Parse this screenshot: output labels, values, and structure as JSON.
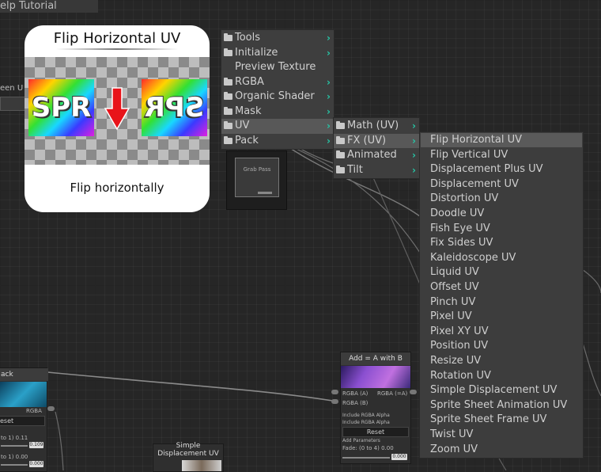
{
  "window": {
    "title": "elp Tutorial"
  },
  "left_panel": {
    "label": "een U"
  },
  "preview": {
    "title": "Flip Horizontal UV",
    "sprite_text": "SPR",
    "caption": "Flip horizontally"
  },
  "menu1": {
    "items": [
      {
        "label": "Tools",
        "folder": true,
        "submenu": true
      },
      {
        "label": "Initialize",
        "folder": true,
        "submenu": true
      },
      {
        "label": "Preview Texture",
        "folder": false,
        "submenu": false
      },
      {
        "label": "RGBA",
        "folder": true,
        "submenu": true
      },
      {
        "label": "Organic Shader",
        "folder": true,
        "submenu": true
      },
      {
        "label": "Mask",
        "folder": true,
        "submenu": true
      },
      {
        "label": "UV",
        "folder": true,
        "submenu": true,
        "selected": true
      },
      {
        "label": "Pack",
        "folder": true,
        "submenu": true
      }
    ]
  },
  "menu2": {
    "items": [
      {
        "label": "Math (UV)"
      },
      {
        "label": "FX (UV)",
        "selected": true
      },
      {
        "label": "Animated"
      },
      {
        "label": "Tilt"
      }
    ]
  },
  "menu3": {
    "items": [
      "Flip Horizontal UV",
      "Flip Vertical UV",
      "Displacement Plus UV",
      "Displacement UV",
      "Distortion UV",
      "Doodle UV",
      "Fish Eye UV",
      "Fix Sides UV",
      "Kaleidoscope UV",
      "Liquid UV",
      "Offset UV",
      "Pinch UV",
      "Pixel UV",
      "Pixel XY UV",
      "Position UV",
      "Resize UV",
      "Rotation UV",
      "Simple Displacement UV",
      "Sprite Sheet Animation UV",
      "Sprite Sheet Frame UV",
      "Twist UV",
      "Zoom UV"
    ]
  },
  "grab_node": {
    "label": "Grab Pass"
  },
  "node_pack": {
    "title": "ack",
    "output": "RGBA",
    "reset": "eset",
    "param1": "to 1) 0.11",
    "param1_value": "0.109",
    "param2": "to 1) 0.00",
    "param2_value": "0.000"
  },
  "node_add": {
    "title": "Add = A with B",
    "in_a": "RGBA (A)",
    "in_b": "RGBA (B)",
    "out": "RGBA (=A)",
    "opt1": "Include RGBA Alpha",
    "opt2": "Include RGBA Alpha",
    "reset": "Reset",
    "opt3": "Add Parameters",
    "fade": "Fade: (0 to 4) 0.00",
    "fade_value": "0.000"
  },
  "node_simple": {
    "title_line1": "Simple",
    "title_line2": "Displacement UV"
  },
  "colors": {
    "accent": "#26c6a6",
    "selected": "#585858",
    "menu_bg": "#3e3e3e"
  }
}
